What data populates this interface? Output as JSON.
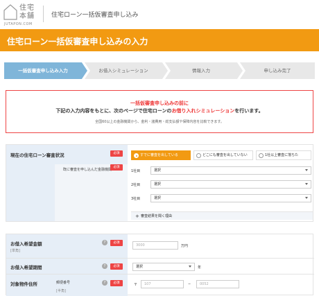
{
  "header": {
    "logo_text": "住宅本舗",
    "logo_sub": "JUTAPON.COM",
    "title": "住宅ローン一括仮審査申し込み"
  },
  "banner": {
    "title": "住宅ローン一括仮審査申し込みの入力"
  },
  "steps": [
    {
      "label": "一括仮審査申し込み入力",
      "active": true
    },
    {
      "label": "お借入シミュレーション",
      "active": false
    },
    {
      "label": "情報入力",
      "active": false
    },
    {
      "label": "申し込み完了",
      "active": false
    }
  ],
  "notice": {
    "title": "一括仮審査申し込みの前に",
    "body_pre": "下記の入力内容をもとに、次のページで住宅ローンの",
    "body_highlight": "お借り入れシミュレーション",
    "body_post": "を行います。",
    "note": "全国60以上の金融機関から、金利・諸費用・総支払額や保障内容を比較できます。"
  },
  "required_label": "必須",
  "current_status": {
    "label": "現在の住宅ローン審査状況",
    "options": [
      {
        "label": "すでに審査を出している",
        "active": true
      },
      {
        "label": "どこにも審査を出していない",
        "active": false
      },
      {
        "label": "1社以上審査に落ちた",
        "active": false
      }
    ]
  },
  "institutions": {
    "label": "既に審査を申し込んだ金融機関",
    "rows": [
      {
        "label": "1社目",
        "value": "選択"
      },
      {
        "label": "2社目",
        "value": "選択"
      },
      {
        "label": "3社目",
        "value": "選択"
      }
    ],
    "reason_button": "審査結果を聞く理由",
    "reason_plus": "+"
  },
  "loan_amount": {
    "label": "お借入希望金額",
    "sub": "[単角]",
    "placeholder": "3000",
    "unit": "万円",
    "help": "?"
  },
  "loan_period": {
    "label": "お借入希望期間",
    "value": "選択",
    "unit": "年",
    "help": "?"
  },
  "property_address": {
    "label": "対象物件住所",
    "sub_label": "郵便番号",
    "sub": "[半角]",
    "prefix": "〒",
    "zip1_placeholder": "107",
    "dash": "−",
    "zip2_placeholder": "0052",
    "help": "?"
  },
  "colors": {
    "brand": "#f29a12",
    "step_active": "#7fb5d9",
    "required": "#e44444",
    "label_bg": "#e6eef7"
  }
}
